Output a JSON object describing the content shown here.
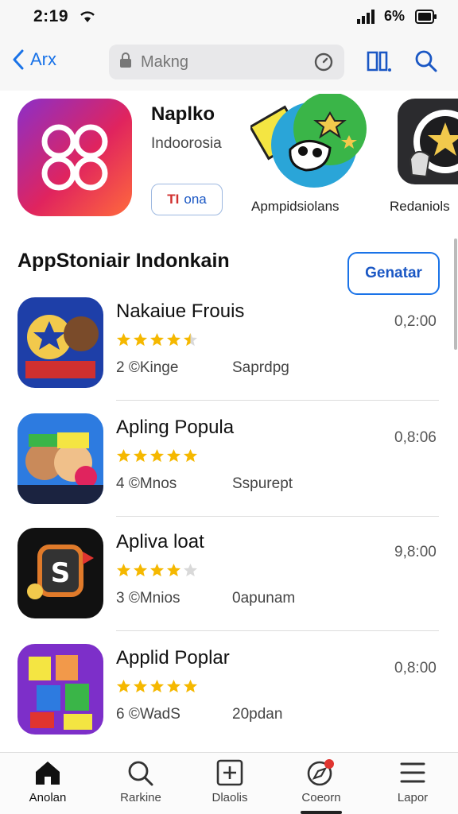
{
  "status_bar": {
    "time": "2:19",
    "battery_percent": "6%"
  },
  "nav": {
    "back_label": "Arx",
    "search_placeholder": "Makng"
  },
  "featured": {
    "main_title": "Naplko",
    "main_subtitle": "Indoorosia",
    "main_button_part1": "ΤΙ",
    "main_button_part2": "ona",
    "mid_label": "Apmpidsiolans",
    "right_label": "Redaniols"
  },
  "section": {
    "title": "AppStoniair Indonkain",
    "button_label": "Genatar"
  },
  "apps": [
    {
      "name": "Nakaiue Frouis",
      "rating": 4.5,
      "meta1": "2 ©Kinge",
      "meta2": "Saprdpg",
      "time": "0,2:00"
    },
    {
      "name": "Apling Popula",
      "rating": 5,
      "meta1": "4 ©Mnos",
      "meta2": "Sspurept",
      "time": "0,8:06"
    },
    {
      "name": "Apliva loat",
      "rating": 4,
      "meta1": "3 ©Mnios",
      "meta2": "0apunam",
      "time": "9,8:00"
    },
    {
      "name": "Applid Poplar",
      "rating": 5,
      "meta1": "6 ©WadS",
      "meta2": "20pdan",
      "time": "0,8:00"
    }
  ],
  "tabs": [
    {
      "label": "Anolan",
      "icon": "home-icon"
    },
    {
      "label": "Rarkine",
      "icon": "search-icon"
    },
    {
      "label": "Dlaolis",
      "icon": "plus-box-icon"
    },
    {
      "label": "Coeorn",
      "icon": "compass-icon",
      "badge": true
    },
    {
      "label": "Lapor",
      "icon": "menu-icon"
    }
  ],
  "colors": {
    "accent": "#1a73e8",
    "star": "#f5b800"
  }
}
